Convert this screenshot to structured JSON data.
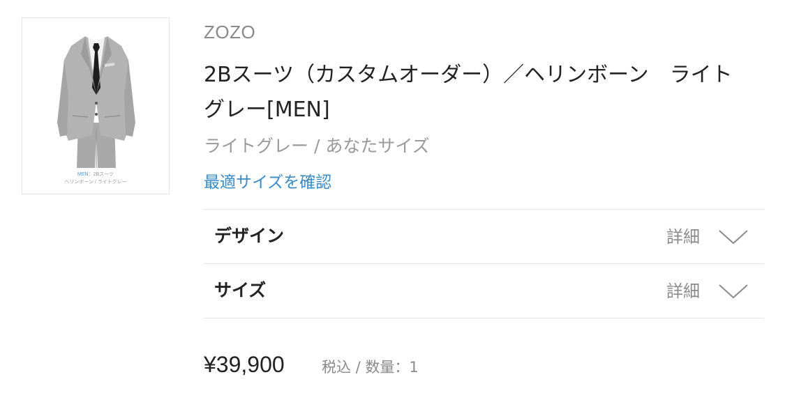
{
  "thumbnail": {
    "caption_accent": "MEN",
    "caption_line1_rest": "：2Bスーツ",
    "caption_line2": "ヘリンボーン / ライトグレー"
  },
  "product": {
    "brand": "ZOZO",
    "title": "2Bスーツ（カスタムオーダー）／ヘリンボーン　ライトグレー[MEN]",
    "variant": "ライトグレー / あなたサイズ",
    "size_link": "最適サイズを確認"
  },
  "rows": [
    {
      "label": "デザイン",
      "detail": "詳細",
      "icon": "chevron-down-icon"
    },
    {
      "label": "サイズ",
      "detail": "詳細",
      "icon": "chevron-down-icon"
    }
  ],
  "price": {
    "amount": "¥39,900",
    "note": "税込 / 数量：1"
  },
  "colors": {
    "link": "#3a8ac4",
    "muted": "#8a8a8a",
    "divider": "#e4e4e4"
  }
}
